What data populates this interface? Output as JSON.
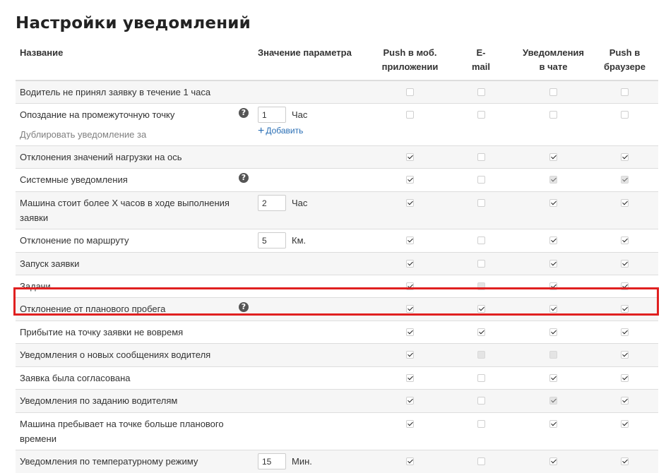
{
  "title": "Настройки уведомлений",
  "header": {
    "name": "Название",
    "value": "Значение параметра",
    "push_mobile": "Push в моб. приложении",
    "email": "E-mail",
    "chat": "Уведомления в чате",
    "push_browser": "Push в браузере"
  },
  "rows": [
    {
      "name": "Водитель не принял заявку в течение 1 часа",
      "help": false,
      "checks": [
        "off",
        "off",
        "off",
        "off"
      ]
    },
    {
      "name": "Опоздание на промежуточную точку",
      "help": true,
      "value": "1",
      "unit": "Час",
      "sub": "Дублировать уведомление за",
      "add_label": "Добавить",
      "checks": [
        "off",
        "off",
        "off",
        "off"
      ]
    },
    {
      "name": "Отклонения значений нагрузки на ось",
      "help": false,
      "checks": [
        "on",
        "off",
        "on",
        "on"
      ]
    },
    {
      "name": "Системные уведомления",
      "help": true,
      "checks": [
        "on",
        "off",
        "dis-on",
        "dis-on"
      ]
    },
    {
      "name": "Машина стоит более X часов в ходе выполнения заявки",
      "help": false,
      "value": "2",
      "unit": "Час",
      "checks": [
        "on",
        "off",
        "on",
        "on"
      ]
    },
    {
      "name": "Отклонение по маршруту",
      "help": false,
      "value": "5",
      "unit": "Км.",
      "checks": [
        "on",
        "off",
        "on",
        "on"
      ]
    },
    {
      "name": "Запуск заявки",
      "help": false,
      "checks": [
        "on",
        "off",
        "on",
        "on"
      ]
    },
    {
      "name": "Задачи",
      "help": false,
      "checks": [
        "on",
        "dis",
        "on",
        "on"
      ]
    },
    {
      "name": "Отклонение от планового пробега",
      "help": true,
      "checks": [
        "on",
        "on",
        "on",
        "on"
      ]
    },
    {
      "name": "Прибытие на точку заявки не вовремя",
      "help": false,
      "checks": [
        "on",
        "on",
        "on",
        "on"
      ]
    },
    {
      "name": "Уведомления о новых сообщениях водителя",
      "help": false,
      "checks": [
        "on",
        "dis",
        "dis",
        "on"
      ]
    },
    {
      "name": "Заявка была согласована",
      "help": false,
      "checks": [
        "on",
        "off",
        "on",
        "on"
      ]
    },
    {
      "name": "Уведомления по заданию водителям",
      "help": false,
      "checks": [
        "on",
        "off",
        "dis-on",
        "on"
      ]
    },
    {
      "name": "Машина пребывает на точке больше планового времени",
      "help": false,
      "checks": [
        "on",
        "off",
        "on",
        "on"
      ]
    },
    {
      "name": "Уведомления по температурному режиму",
      "help": false,
      "value": "15",
      "unit": "Мин.",
      "checks": [
        "on",
        "off",
        "on",
        "on"
      ]
    }
  ],
  "help_glyph": "?",
  "highlight_color": "#e02020"
}
